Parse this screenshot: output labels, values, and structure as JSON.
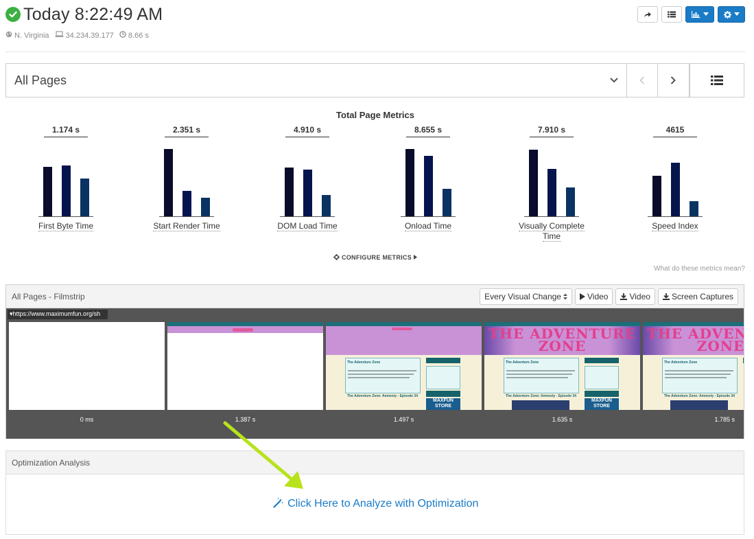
{
  "header": {
    "title": "Today 8:22:49 AM",
    "location": "N. Virginia",
    "ip": "34.234.39.177",
    "duration": "8.66 s",
    "buttons": [
      "share-icon",
      "list-icon",
      "chart-icon",
      "gear-icon"
    ]
  },
  "page_select": {
    "label": "All Pages"
  },
  "metrics": {
    "title": "Total Page Metrics",
    "items": [
      {
        "value": "1.174 s",
        "name": "First Byte Time",
        "bars": [
          0.72,
          0.74,
          0.55
        ]
      },
      {
        "value": "2.351 s",
        "name": "Start Render Time",
        "bars": [
          0.98,
          0.37,
          0.27
        ]
      },
      {
        "value": "4.910 s",
        "name": "DOM Load Time",
        "bars": [
          0.71,
          0.68,
          0.31
        ]
      },
      {
        "value": "8.655 s",
        "name": "Onload Time",
        "bars": [
          0.98,
          0.88,
          0.4
        ]
      },
      {
        "value": "7.910 s",
        "name": "Visually Complete Time",
        "bars": [
          0.97,
          0.69,
          0.42
        ]
      },
      {
        "value": "4615",
        "name": "Speed Index",
        "bars": [
          0.59,
          0.78,
          0.22
        ]
      }
    ],
    "bar_colors": [
      "#0b0b2b",
      "#06144e",
      "#0a3363"
    ],
    "configure_label": "CONFIGURE METRICS",
    "what_mean": "What do these metrics mean?"
  },
  "filmstrip": {
    "title": "All Pages - Filmstrip",
    "select_label": "Every Visual Change",
    "video_label": "Video",
    "download_video_label": "Video",
    "screen_captures_label": "Screen Captures",
    "url": "https://www.maximumfun.org/sh",
    "frames": [
      {
        "time": "0 ms"
      },
      {
        "time": "1.387 s"
      },
      {
        "time": "1.497 s"
      },
      {
        "time": "1.635 s"
      },
      {
        "time": "1.785 s"
      }
    ],
    "banner_text": "THE ADVENTURE ZONE",
    "heading": "The Adventure Zone",
    "episode_text": "The Adventure Zone: Amnesty - Episode 34",
    "store_label": "MAXFUN STORE"
  },
  "optimization": {
    "title": "Optimization Analysis",
    "link_label": "Click Here to Analyze with Optimization"
  },
  "colors": {
    "accent": "#1a7bc6",
    "success": "#3cb043",
    "arrow": "#b8e21c"
  }
}
